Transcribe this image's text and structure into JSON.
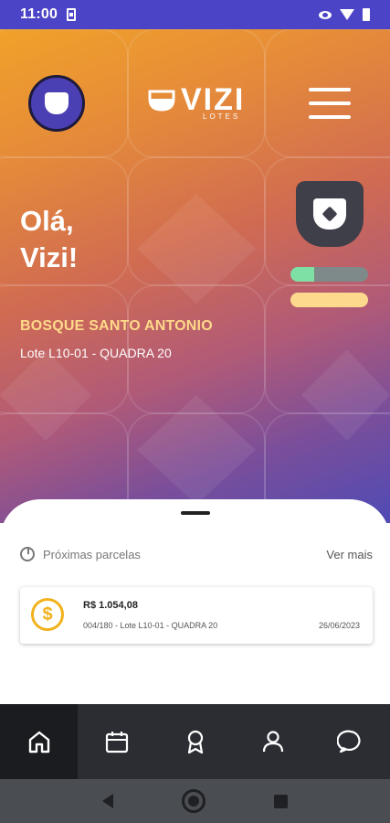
{
  "status_bar": {
    "time": "11:00"
  },
  "header": {
    "logo_text": "VIZI",
    "logo_subtext": "LOTES",
    "icons": {
      "avatar": "shield-avatar-icon",
      "menu": "hamburger-menu-icon"
    }
  },
  "greeting": {
    "line1": "Olá,",
    "line2": "Vizi!"
  },
  "property": {
    "name": "BOSQUE SANTO ANTONIO",
    "lot": "Lote L10-01 - QUADRA 20"
  },
  "progress": {
    "primary_fraction": 0.3,
    "primary_color": "#7ee0a5",
    "secondary_color": "#fdd98e"
  },
  "installments": {
    "title": "Próximas parcelas",
    "see_more": "Ver mais",
    "items": [
      {
        "amount": "R$ 1.054,08",
        "description": "004/180 - Lote L10-01 - QUADRA 20",
        "date": "26/06/2023",
        "icon": "dollar-coin-icon"
      }
    ]
  },
  "tabs": [
    {
      "name": "home",
      "icon": "home-icon",
      "active": true
    },
    {
      "name": "calendar",
      "icon": "calendar-icon",
      "active": false
    },
    {
      "name": "award",
      "icon": "award-icon",
      "active": false
    },
    {
      "name": "profile",
      "icon": "user-icon",
      "active": false
    },
    {
      "name": "chat",
      "icon": "chat-icon",
      "active": false
    }
  ],
  "colors": {
    "status_bar": "#4b44c7",
    "accent_gold": "#ffd98a",
    "coin": "#f2b21d",
    "tabbar": "#2b2d33"
  }
}
